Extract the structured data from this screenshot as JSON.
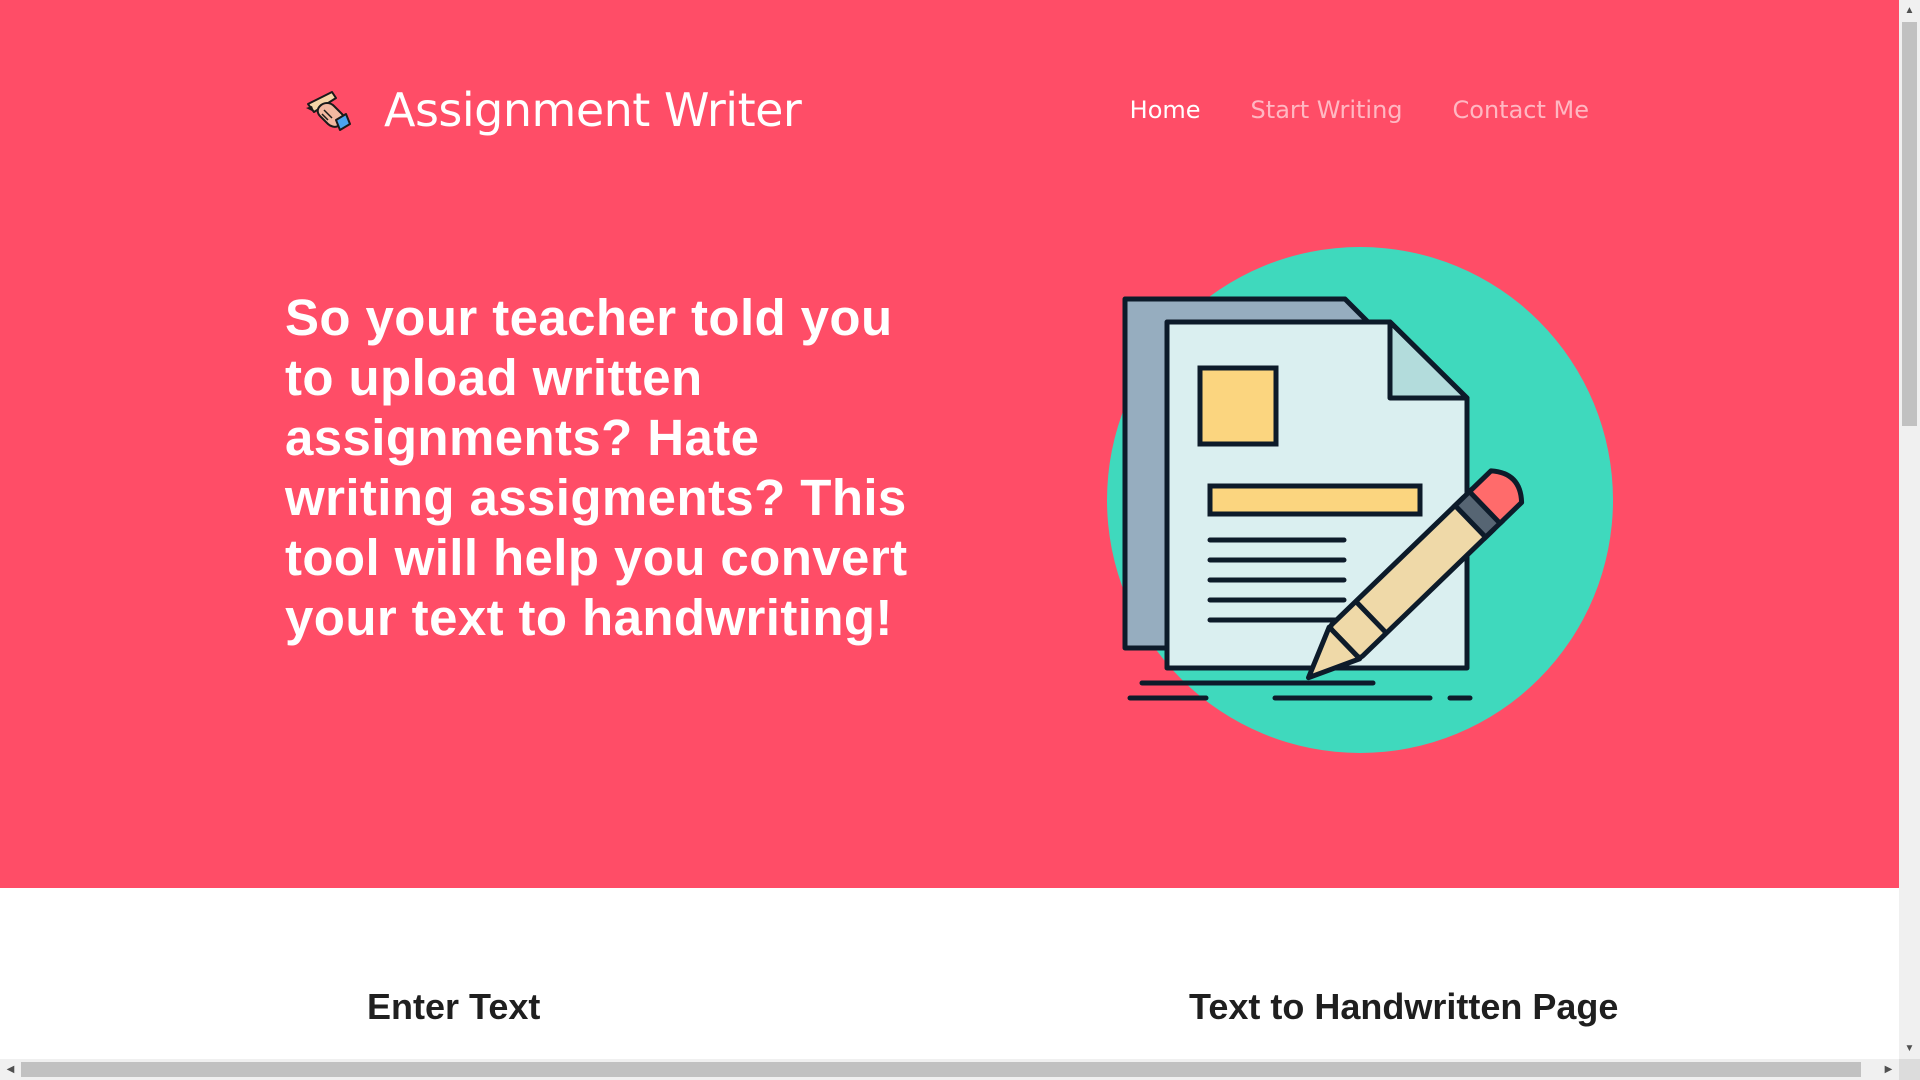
{
  "brand": {
    "title": "Assignment Writer",
    "icon": "hand-writing-icon"
  },
  "nav": {
    "items": [
      {
        "label": "Home",
        "active": true
      },
      {
        "label": "Start Writing",
        "active": false
      },
      {
        "label": "Contact Me",
        "active": false
      }
    ]
  },
  "hero": {
    "headline": "So your teacher told you to upload written assignments? Hate writing assigments? This tool will help you convert your text to handwriting!",
    "illustration": "document-pencil-icon"
  },
  "sections": {
    "enter_text_heading": "Enter Text",
    "output_heading": "Text to Handwritten Page"
  },
  "colors": {
    "hero_background": "#ff4d67",
    "illustration_circle": "#3fd9bd",
    "page_fill": "#daeff0",
    "accent_yellow": "#fbd57f",
    "pencil_tip": "#ff6b6b",
    "outline": "#0d1b2a"
  },
  "scrollbars": {
    "arrow_up": "▲",
    "arrow_down": "▼",
    "arrow_left": "◀",
    "arrow_right": "▶"
  }
}
